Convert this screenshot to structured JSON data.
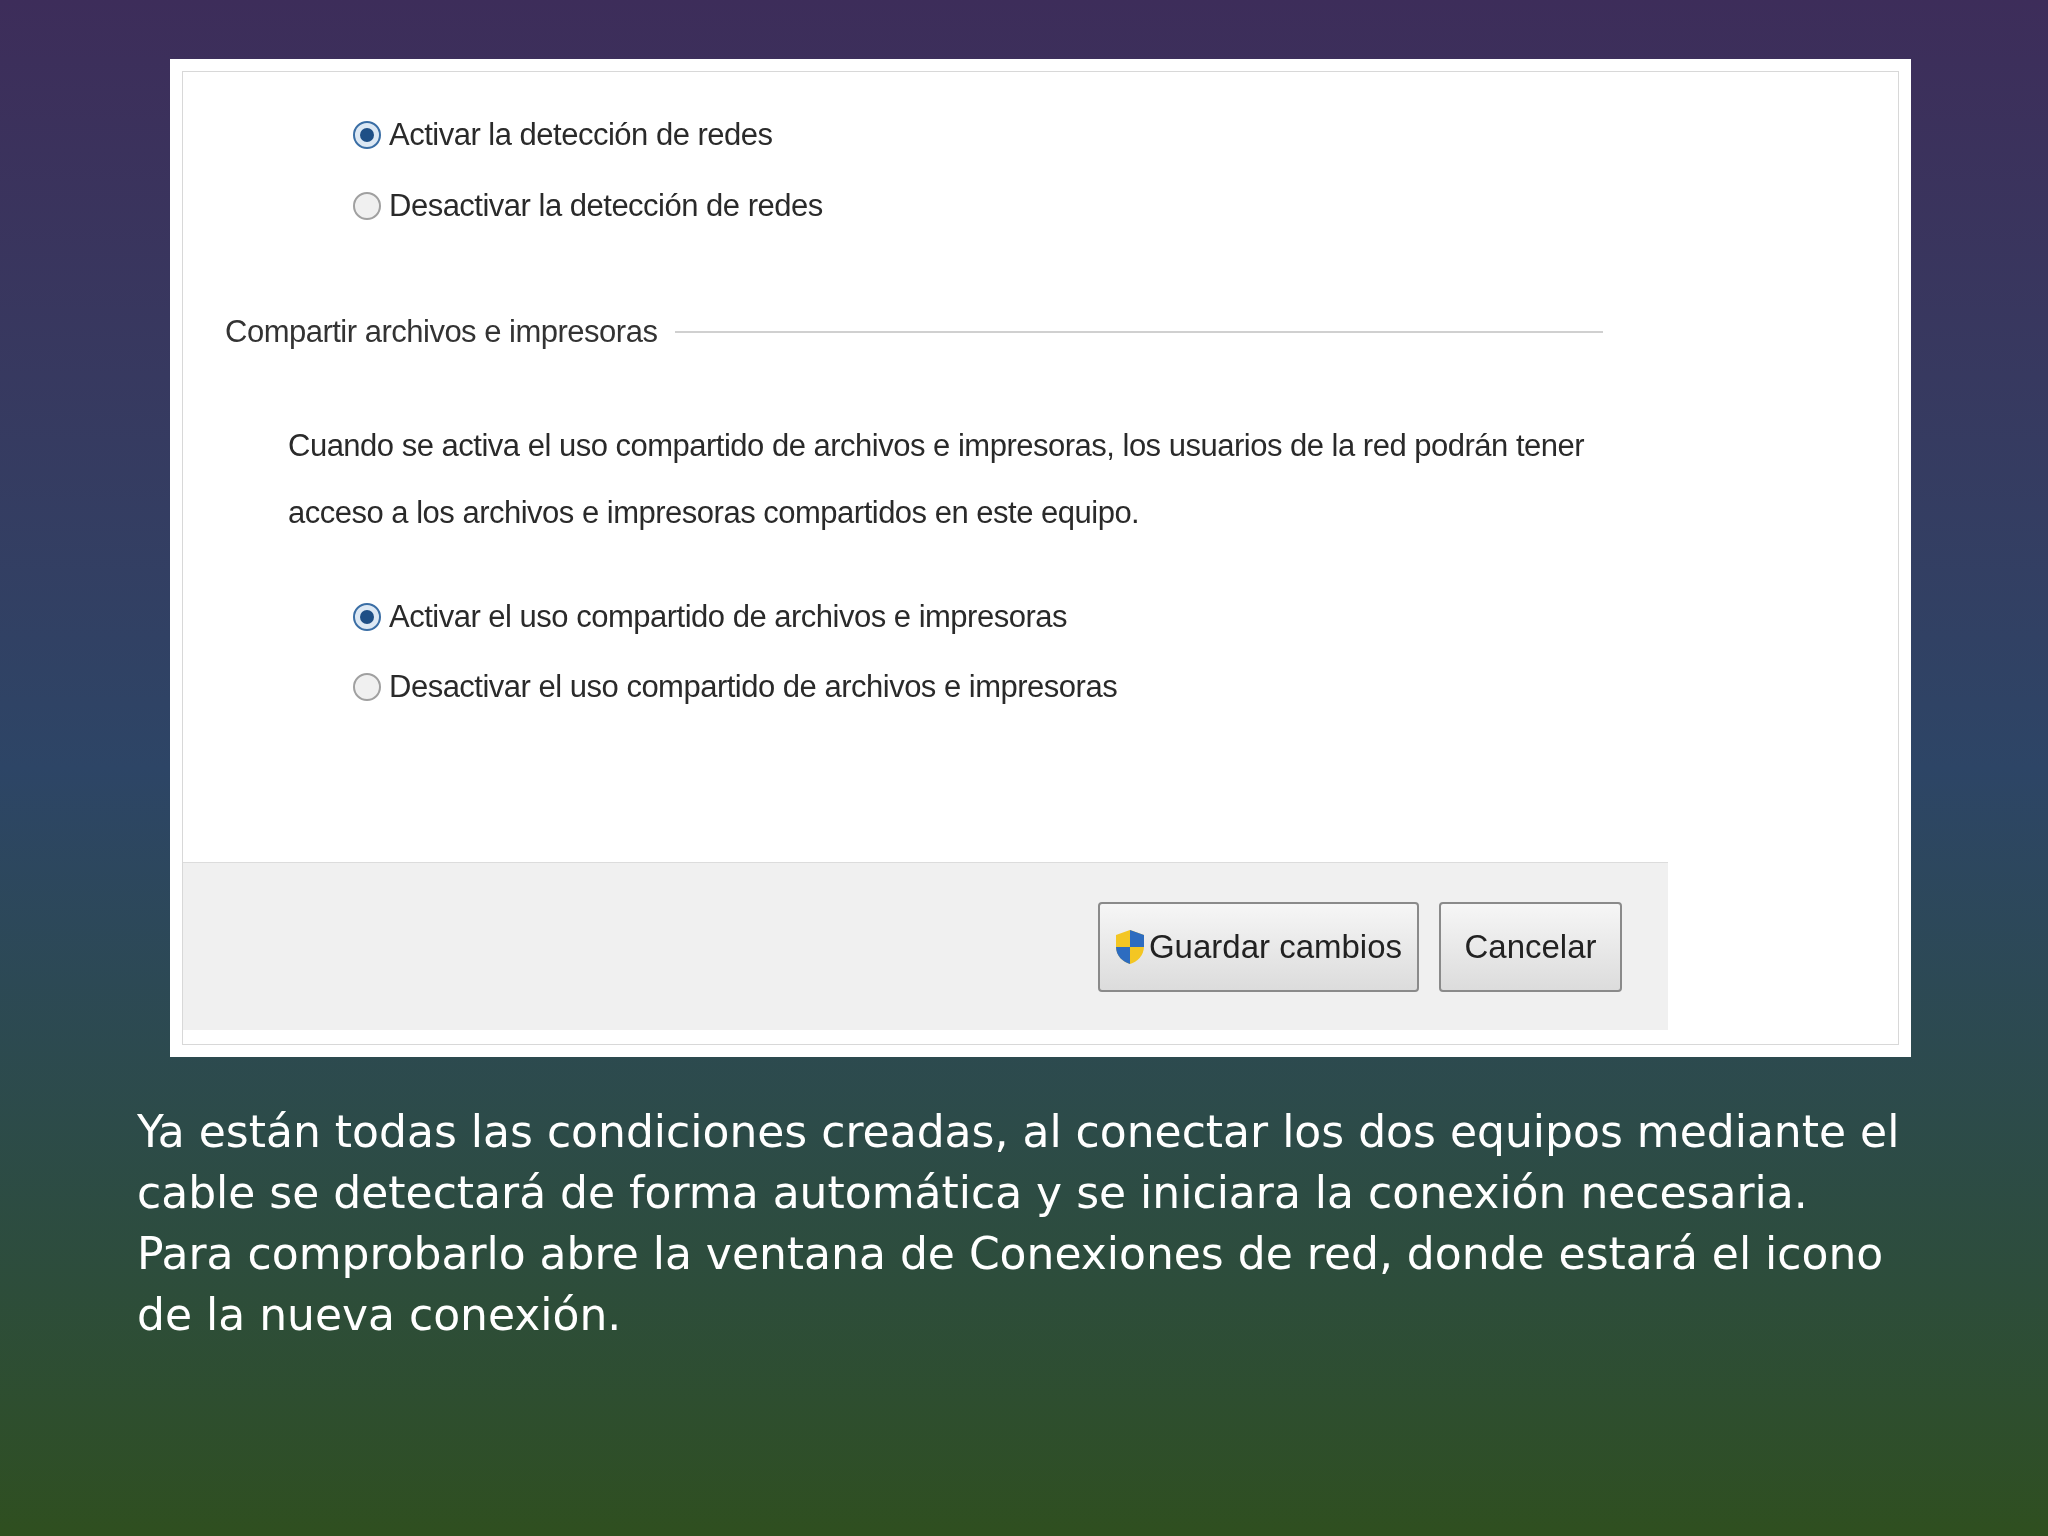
{
  "dialog": {
    "network_discovery_options": [
      {
        "label": "Activar la detección de redes",
        "selected": true
      },
      {
        "label": "Desactivar la detección de redes",
        "selected": false
      }
    ],
    "sharing_section": {
      "heading": "Compartir archivos e impresoras",
      "description": "Cuando se activa el uso compartido de archivos e impresoras, los usuarios de la red podrán tener acceso a los archivos e impresoras compartidos en este equipo.",
      "options": [
        {
          "label": "Activar el uso compartido de archivos e impresoras",
          "selected": true
        },
        {
          "label": "Desactivar el uso compartido de archivos e impresoras",
          "selected": false
        }
      ]
    },
    "buttons": [
      {
        "label": "Guardar cambios",
        "kind": "shield"
      },
      {
        "label": "Cancelar",
        "kind": "plain"
      }
    ]
  },
  "caption": [
    "Ya están todas las condiciones creadas, al conectar los dos equipos mediante el cable se detectará de forma automática y se iniciara la conexión necesaria.",
    "Para comprobarlo abre la ventana de Conexiones de red, donde estará el icono de la nueva conexión."
  ]
}
